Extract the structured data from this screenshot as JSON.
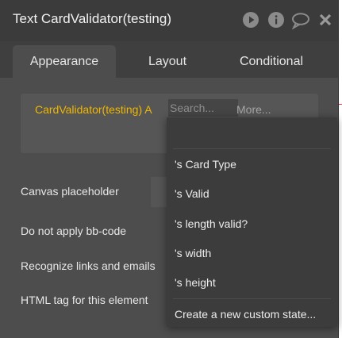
{
  "header": {
    "title": "Text CardValidator(testing)"
  },
  "tabs": [
    {
      "label": "Appearance",
      "active": true
    },
    {
      "label": "Layout",
      "active": false
    },
    {
      "label": "Conditional",
      "active": false
    }
  ],
  "expression": {
    "text": "CardValidator(testing) A",
    "search_placeholder": "Search...",
    "more_label": "More..."
  },
  "properties": {
    "canvas_placeholder": "Canvas placeholder",
    "no_bbcode": "Do not apply bb-code",
    "recognize_links": "Recognize links and emails",
    "html_tag": "HTML tag for this element"
  },
  "dropdown": {
    "items": [
      "'s Card Type",
      "'s Valid",
      "'s length valid?",
      "'s width",
      "'s height"
    ],
    "create_state": "Create a new custom state..."
  },
  "colors": {
    "accent_expression": "#f0b700",
    "panel": "#4d4d4d",
    "header": "#3b3b3b",
    "dropdown": "#3c3c3c"
  }
}
